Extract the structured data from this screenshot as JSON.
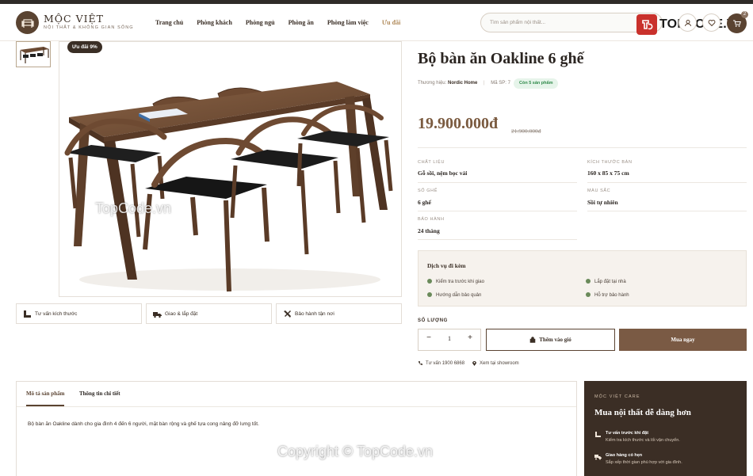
{
  "brand": {
    "name": "MỘC VIỆT",
    "tagline": "NỘI THẤT & KHÔNG GIAN SỐNG",
    "accent": "#7a5a44",
    "dark": "#3b2e25"
  },
  "nav": {
    "items": [
      {
        "label": "Trang chủ"
      },
      {
        "label": "Phòng khách"
      },
      {
        "label": "Phòng ngủ"
      },
      {
        "label": "Phòng ăn"
      },
      {
        "label": "Phòng làm việc"
      },
      {
        "label": "Ưu đãi"
      }
    ]
  },
  "search": {
    "placeholder": "Tìm sản phẩm nội thất..."
  },
  "cart": {
    "count": "2"
  },
  "watermark": {
    "logo_text": "TOPCODE.VN",
    "mid_text": "TopCode.vn",
    "copyright": "Copyright © TopCode.vn"
  },
  "gallery": {
    "sale_badge": "Ưu đãi 9%",
    "features": [
      {
        "label": "Tư vấn kích thước",
        "icon": "ruler-icon"
      },
      {
        "label": "Giao & lắp đặt",
        "icon": "truck-icon"
      },
      {
        "label": "Bảo hành tận nơi",
        "icon": "tools-icon"
      }
    ]
  },
  "product": {
    "title": "Bộ bàn ăn Oakline 6 ghế",
    "brand_label": "Thương hiệu:",
    "brand_value": "Nordic Home",
    "sku_label": "Mã SP:",
    "sku_value": "7",
    "stock": "Còn 5 sản phẩm",
    "price": "19.900.000đ",
    "old_price": "21.900.000đ",
    "specs": [
      {
        "label": "CHẤT LIỆU",
        "value": "Gỗ sồi, nệm bọc vải"
      },
      {
        "label": "KÍCH THƯỚC BÀN",
        "value": "160 x 85 x 75 cm"
      },
      {
        "label": "SỐ GHẾ",
        "value": "6 ghế"
      },
      {
        "label": "MÀU SẮC",
        "value": "Sồi tự nhiên"
      },
      {
        "label": "BẢO HÀNH",
        "value": "24 tháng"
      }
    ]
  },
  "services": {
    "title": "Dịch vụ đi kèm",
    "items": [
      {
        "label": "Kiểm tra trước khi giao"
      },
      {
        "label": "Lắp đặt tại nhà"
      },
      {
        "label": "Hướng dẫn bảo quản"
      },
      {
        "label": "Hỗ trợ bảo hành"
      }
    ]
  },
  "purchase": {
    "qty_label": "SỐ LƯỢNG",
    "qty": "1",
    "minus": "−",
    "plus": "+",
    "add_to_cart": "Thêm vào giỏ",
    "buy_now": "Mua ngay",
    "phone": "Tư vấn 1900 6868",
    "showroom": "Xem tại showroom"
  },
  "tabs": {
    "items": [
      {
        "label": "Mô tả sản phẩm"
      },
      {
        "label": "Thông tin chi tiết"
      }
    ],
    "description": "Bộ bàn ăn Oakline dành cho gia đình 4 đến 6 người, mặt bàn rộng và ghế tựa cong nâng đỡ lưng tốt."
  },
  "care": {
    "eyebrow": "MỘC VIỆT CARE",
    "title": "Mua nội thất dễ dàng hơn",
    "items": [
      {
        "title": "Tư vấn trước khi đặt",
        "desc": "Kiểm tra kích thước và lối vận chuyển.",
        "icon": "ruler-icon"
      },
      {
        "title": "Giao hàng có hẹn",
        "desc": "Sắp xếp thời gian phù hợp với gia đình.",
        "icon": "truck-icon"
      }
    ]
  }
}
